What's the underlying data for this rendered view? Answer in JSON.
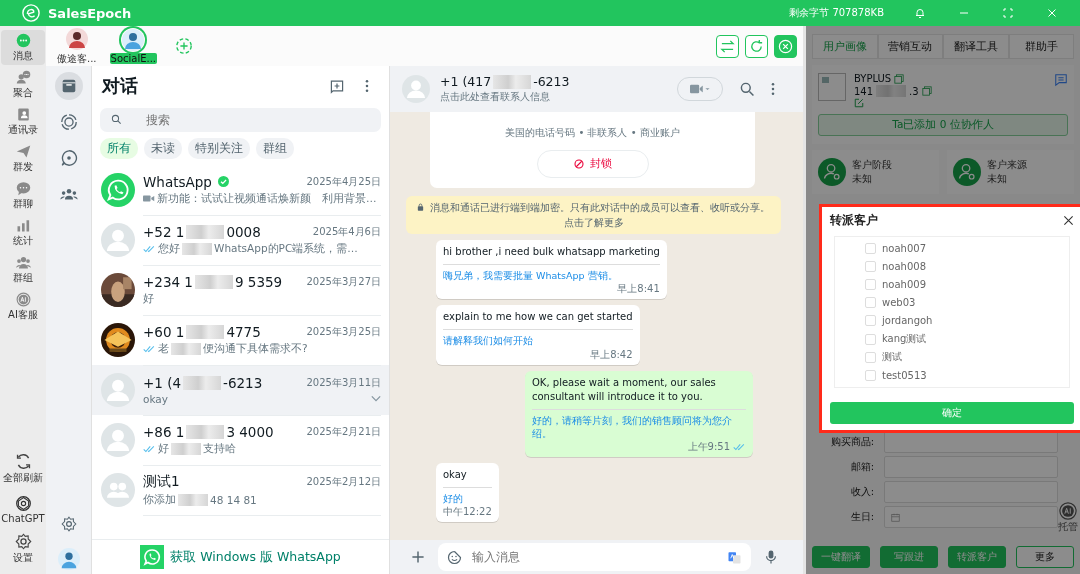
{
  "app": {
    "title": "SalesEpoch",
    "storage": "剩余字节 707878KB"
  },
  "nav": {
    "items": [
      {
        "label": "消息",
        "selected": true
      },
      {
        "label": "聚合",
        "selected": false
      },
      {
        "label": "通讯录",
        "selected": false
      },
      {
        "label": "群发",
        "selected": false
      },
      {
        "label": "群聊",
        "selected": false
      },
      {
        "label": "统计",
        "selected": false
      },
      {
        "label": "群组",
        "selected": false
      },
      {
        "label": "AI客服",
        "selected": false
      }
    ],
    "bottom": [
      {
        "label": "全部刷新"
      },
      {
        "label": "ChatGPT"
      },
      {
        "label": "设置"
      }
    ]
  },
  "accounts": [
    {
      "label": "傲途客...",
      "selected": false
    },
    {
      "label": "SocialE...",
      "selected": true
    }
  ],
  "rail": [
    {
      "selected": true
    },
    {
      "selected": false
    },
    {
      "selected": false
    },
    {
      "selected": false
    }
  ],
  "chat_list": {
    "title": "对话",
    "search": {
      "placeholder": "搜索"
    },
    "filters": [
      {
        "label": "所有",
        "selected": true
      },
      {
        "label": "未读",
        "selected": false
      },
      {
        "label": "特别关注",
        "selected": false
      },
      {
        "label": "群组",
        "selected": false
      }
    ],
    "chats": [
      {
        "kind": "brand",
        "name": [
          "WhatsApp"
        ],
        "verified": true,
        "date": "2025年4月25日",
        "video": true,
        "ticks": false,
        "preview": [
          "新功能：试试让视频通话焕新颜　利用背景…"
        ],
        "selected": false
      },
      {
        "kind": "person",
        "name": [
          "+52 1",
          "0008"
        ],
        "verified": false,
        "date": "2025年4月6日",
        "video": false,
        "ticks": true,
        "preview": [
          "您好",
          "WhatsApp的PC端系统，需…"
        ],
        "selected": false
      },
      {
        "name": [
          "+234 1",
          "9 5359"
        ],
        "verified": false,
        "date": "2025年3月27日",
        "video": false,
        "ticks": false,
        "preview": [
          "好"
        ],
        "selected": false
      },
      {
        "kind": "emblem",
        "name": [
          "+60 1",
          "4775"
        ],
        "verified": false,
        "date": "2025年3月25日",
        "video": false,
        "ticks": true,
        "preview": [
          "老",
          "便沟通下具体需求不?"
        ],
        "selected": false
      },
      {
        "kind": "person",
        "name": [
          "+1 (4",
          "-6213"
        ],
        "verified": false,
        "date": "2025年3月11日",
        "video": false,
        "ticks": false,
        "preview": [
          "okay"
        ],
        "selected": true
      },
      {
        "kind": "person",
        "name": [
          "+86 1",
          "3 4000"
        ],
        "verified": false,
        "date": "2025年2月21日",
        "video": false,
        "ticks": true,
        "preview": [
          "好",
          "支持哈"
        ],
        "selected": false
      },
      {
        "kind": "group",
        "name": [
          "测试1"
        ],
        "verified": false,
        "date": "2025年2月12日",
        "video": false,
        "ticks": false,
        "preview": [
          "你添加",
          "48 14 81"
        ],
        "selected": false
      }
    ],
    "banner": "获取 Windows 版 WhatsApp"
  },
  "conversation": {
    "name": [
      "+1 (417",
      "-6213"
    ],
    "subtitle": "点击此处查看联系人信息",
    "contact_card": {
      "details": "美国的电话号码 • 非联系人 • 商业账户",
      "block": "封锁"
    },
    "notice": "消息和通话已进行端到端加密。只有此对话中的成员可以查看、收听或分享。点击了解更多",
    "messages": [
      {
        "kind": "incoming",
        "text": "hi brother ,i need bulk whatsapp marketing",
        "translation": "嗨兄弟，我需要批量 WhatsApp 营销。",
        "time": "早上8:41",
        "read": false
      },
      {
        "kind": "incoming",
        "text": "explain to me how we can get started",
        "translation": "请解释我们如何开始",
        "time": "早上8:42",
        "read": false
      },
      {
        "kind": "outgoing",
        "text": "OK, please wait a moment, our sales consultant will introduce it to you.",
        "translation": "好的，请稍等片刻，我们的销售顾问将为您介绍。",
        "time": "上午9:51",
        "read": true
      },
      {
        "kind": "incoming",
        "text": "okay",
        "translation": "好的",
        "time": "中午12:22",
        "read": false
      }
    ],
    "input": {
      "placeholder": "输入消息"
    }
  },
  "side_panel": {
    "tabs": [
      {
        "label": "用户画像",
        "selected": true
      },
      {
        "label": "营销互动",
        "selected": false
      },
      {
        "label": "翻译工具",
        "selected": false
      },
      {
        "label": "群助手",
        "selected": false
      }
    ],
    "profile": {
      "name": "BYPLUS",
      "number": [
        "141",
        ".3"
      ],
      "collaborators": "Ta已添加 0 位协作人"
    },
    "stats": [
      {
        "label": "客户阶段",
        "value": "未知"
      },
      {
        "label": "客户来源",
        "value": "未知"
      }
    ],
    "fields": [
      {
        "kind": "text",
        "label": "购买商品:"
      },
      {
        "kind": "text",
        "label": "邮箱:"
      },
      {
        "kind": "text",
        "label": "收入:"
      },
      {
        "kind": "date",
        "label": "生日:"
      }
    ],
    "ai": "托管",
    "actions": [
      {
        "label": "一键翻译",
        "primary": true
      },
      {
        "label": "写跟进",
        "primary": true
      },
      {
        "label": "转派客户",
        "primary": true
      },
      {
        "label": "更多",
        "primary": false
      }
    ]
  },
  "dialog": {
    "title": "转派客户",
    "options": [
      {
        "label": "noah007",
        "checked": false
      },
      {
        "label": "noah008",
        "checked": false
      },
      {
        "label": "noah009",
        "checked": false
      },
      {
        "label": "web03",
        "checked": false
      },
      {
        "label": "jordangoh",
        "checked": false
      },
      {
        "label": "kang测试",
        "checked": false
      },
      {
        "label": "测试",
        "checked": false
      },
      {
        "label": "test0513",
        "checked": false
      }
    ],
    "confirm": "确定"
  }
}
